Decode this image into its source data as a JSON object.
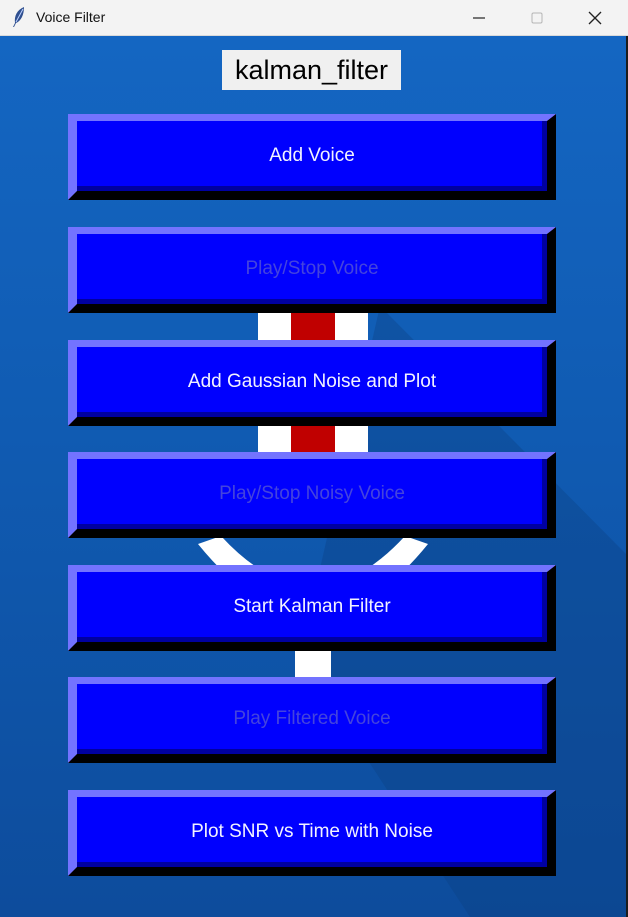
{
  "window": {
    "title": "Voice Filter",
    "app_icon": "feather-icon",
    "controls": [
      "minimize-icon",
      "maximize-icon",
      "close-icon"
    ]
  },
  "header": {
    "label": "kalman_filter"
  },
  "buttons": [
    {
      "label": "Add Voice",
      "enabled": true
    },
    {
      "label": "Play/Stop Voice",
      "enabled": false
    },
    {
      "label": "Add Gaussian Noise and Plot",
      "enabled": true
    },
    {
      "label": "Play/Stop Noisy Voice",
      "enabled": false
    },
    {
      "label": "Start Kalman Filter",
      "enabled": true
    },
    {
      "label": "Play Filtered Voice",
      "enabled": false
    },
    {
      "label": "Plot SNR vs Time with Noise",
      "enabled": true
    }
  ],
  "colors": {
    "button_face": "#0000fe",
    "button_highlight": "#7373ff",
    "button_text": "#f2f2ff",
    "button_text_disabled": "#4444dd",
    "background": "#1466c2",
    "mic_accent": "#c00000"
  }
}
